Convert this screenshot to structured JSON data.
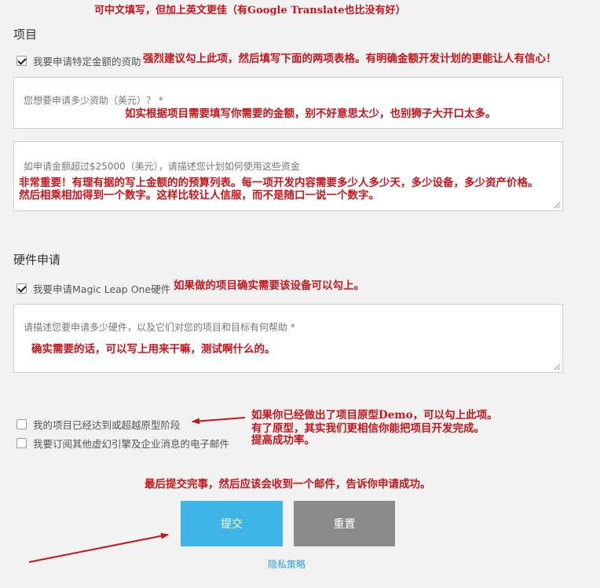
{
  "annotations": {
    "top": "可中文填写，但加上英文更佳（有Google Translate也比没有好）",
    "funding_checkbox": "强烈建议勾上此项，然后填写下面的两项表格。有明确金额开发计划的更能让人有信心！",
    "amount": "如实根据项目需要填写你需要的金额，别不好意思太少，也别狮子大开口太多。",
    "budget_line1": "非常重要！有理有据的写上金额的的预算列表。每一项开发内容需要多少人多少天，多少设备，多少资产价格。",
    "budget_line2": "然后相乘相加得到一个数字。这样比较让人信服，而不是随口一说一个数字。",
    "hardware_checkbox": "如果做的项目确实需要该设备可以勾上。",
    "hardware_desc": "确实需要的话，可以写上用来干嘛，测试啊什么的。",
    "prototype_line1": "如果你已经做出了项目原型Demo，可以勾上此项。",
    "prototype_line2": "有了原型，其实我们更相信你能把项目开发完成。",
    "prototype_line3": "提高成功率。",
    "submit": "最后提交完事，然后应该会收到一个邮件，告诉你申请成功。"
  },
  "project": {
    "title": "项目",
    "funding_checkbox": {
      "label": "我要申请特定金额的资助",
      "checked": true
    },
    "amount_field": {
      "placeholder": "您想要申请多少资助（美元）？ *"
    },
    "budget_field": {
      "placeholder": "如申请金额超过$25000（美元），请描述您计划如何使用这些资金"
    }
  },
  "hardware": {
    "title": "硬件申请",
    "checkbox": {
      "label": "我要申请Magic Leap One硬件",
      "checked": true
    },
    "desc_field": {
      "placeholder": "请描述您要申请多少硬件，以及它们对您的项目和目标有何帮助 *"
    }
  },
  "options": {
    "prototype": {
      "label": "我的项目已经达到或超越原型阶段",
      "checked": false
    },
    "subscribe": {
      "label": "我要订阅其他虚幻引擎及企业消息的电子邮件",
      "checked": false
    }
  },
  "buttons": {
    "submit": "提交",
    "reset": "重置"
  },
  "privacy_link": "隐私策略",
  "colors": {
    "accent": "#3eb4e6",
    "reset": "#8a8a8a",
    "annotation": "#c8141b",
    "link": "#2a9fd8"
  }
}
